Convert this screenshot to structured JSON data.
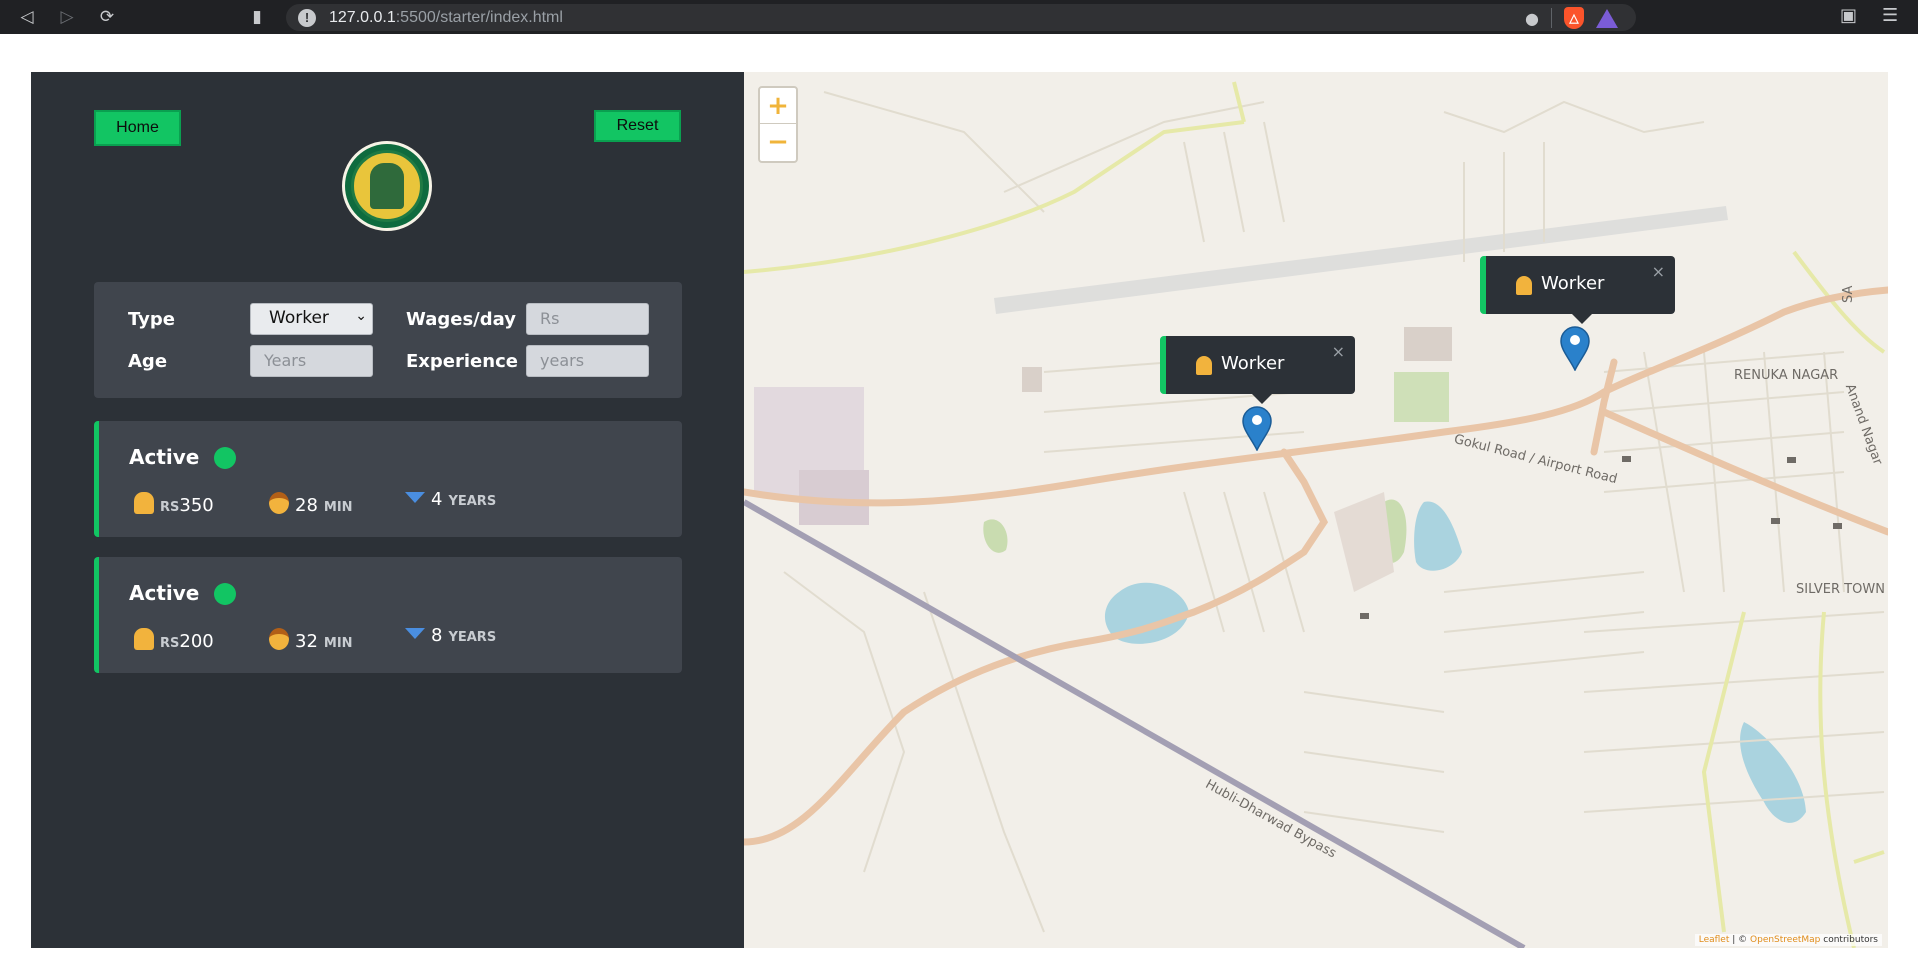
{
  "browser": {
    "url_host": "127.0.0.1",
    "url_path": ":5500/starter/index.html",
    "icons": [
      "back-icon",
      "forward-icon",
      "reload-icon",
      "bookmark-icon",
      "info-icon",
      "location-icon",
      "brave-shields-icon",
      "brave-rewards-icon",
      "wallet-icon",
      "menu-icon"
    ]
  },
  "sidebar": {
    "home_label": "Home",
    "reset_label": "Reset",
    "filters": {
      "type_label": "Type",
      "type_value": "Worker",
      "wages_label": "Wages/day",
      "wages_placeholder": "Rs",
      "age_label": "Age",
      "age_placeholder": "Years",
      "experience_label": "Experience",
      "experience_placeholder": "years"
    },
    "cards": [
      {
        "status": "Active",
        "wage_prefix": "RS",
        "wage": "350",
        "time": "28",
        "time_unit": "MIN",
        "years": "4",
        "years_unit": "YEARS"
      },
      {
        "status": "Active",
        "wage_prefix": "RS",
        "wage": "200",
        "time": "32",
        "time_unit": "MIN",
        "years": "8",
        "years_unit": "YEARS"
      }
    ]
  },
  "map": {
    "zoom_in": "+",
    "zoom_out": "−",
    "popups": [
      {
        "label": "Worker",
        "close": "×"
      },
      {
        "label": "Worker",
        "close": "×"
      }
    ],
    "labels": {
      "renuka": "RENUKA NAGAR",
      "silver": "SILVER TOWN",
      "gokul": "Gokul Road / Airport Road",
      "bypass": "Hubli-Dharwad Bypass",
      "anand": "Anand Nagar",
      "sa": "SA"
    },
    "attribution": {
      "leaflet": "Leaflet",
      "sep": " | © ",
      "osm": "OpenStreetMap",
      "contributors": " contributors"
    },
    "colors": {
      "accent": "#12c563",
      "marker": "#2a81cb",
      "road": "#e9c5a7"
    }
  }
}
